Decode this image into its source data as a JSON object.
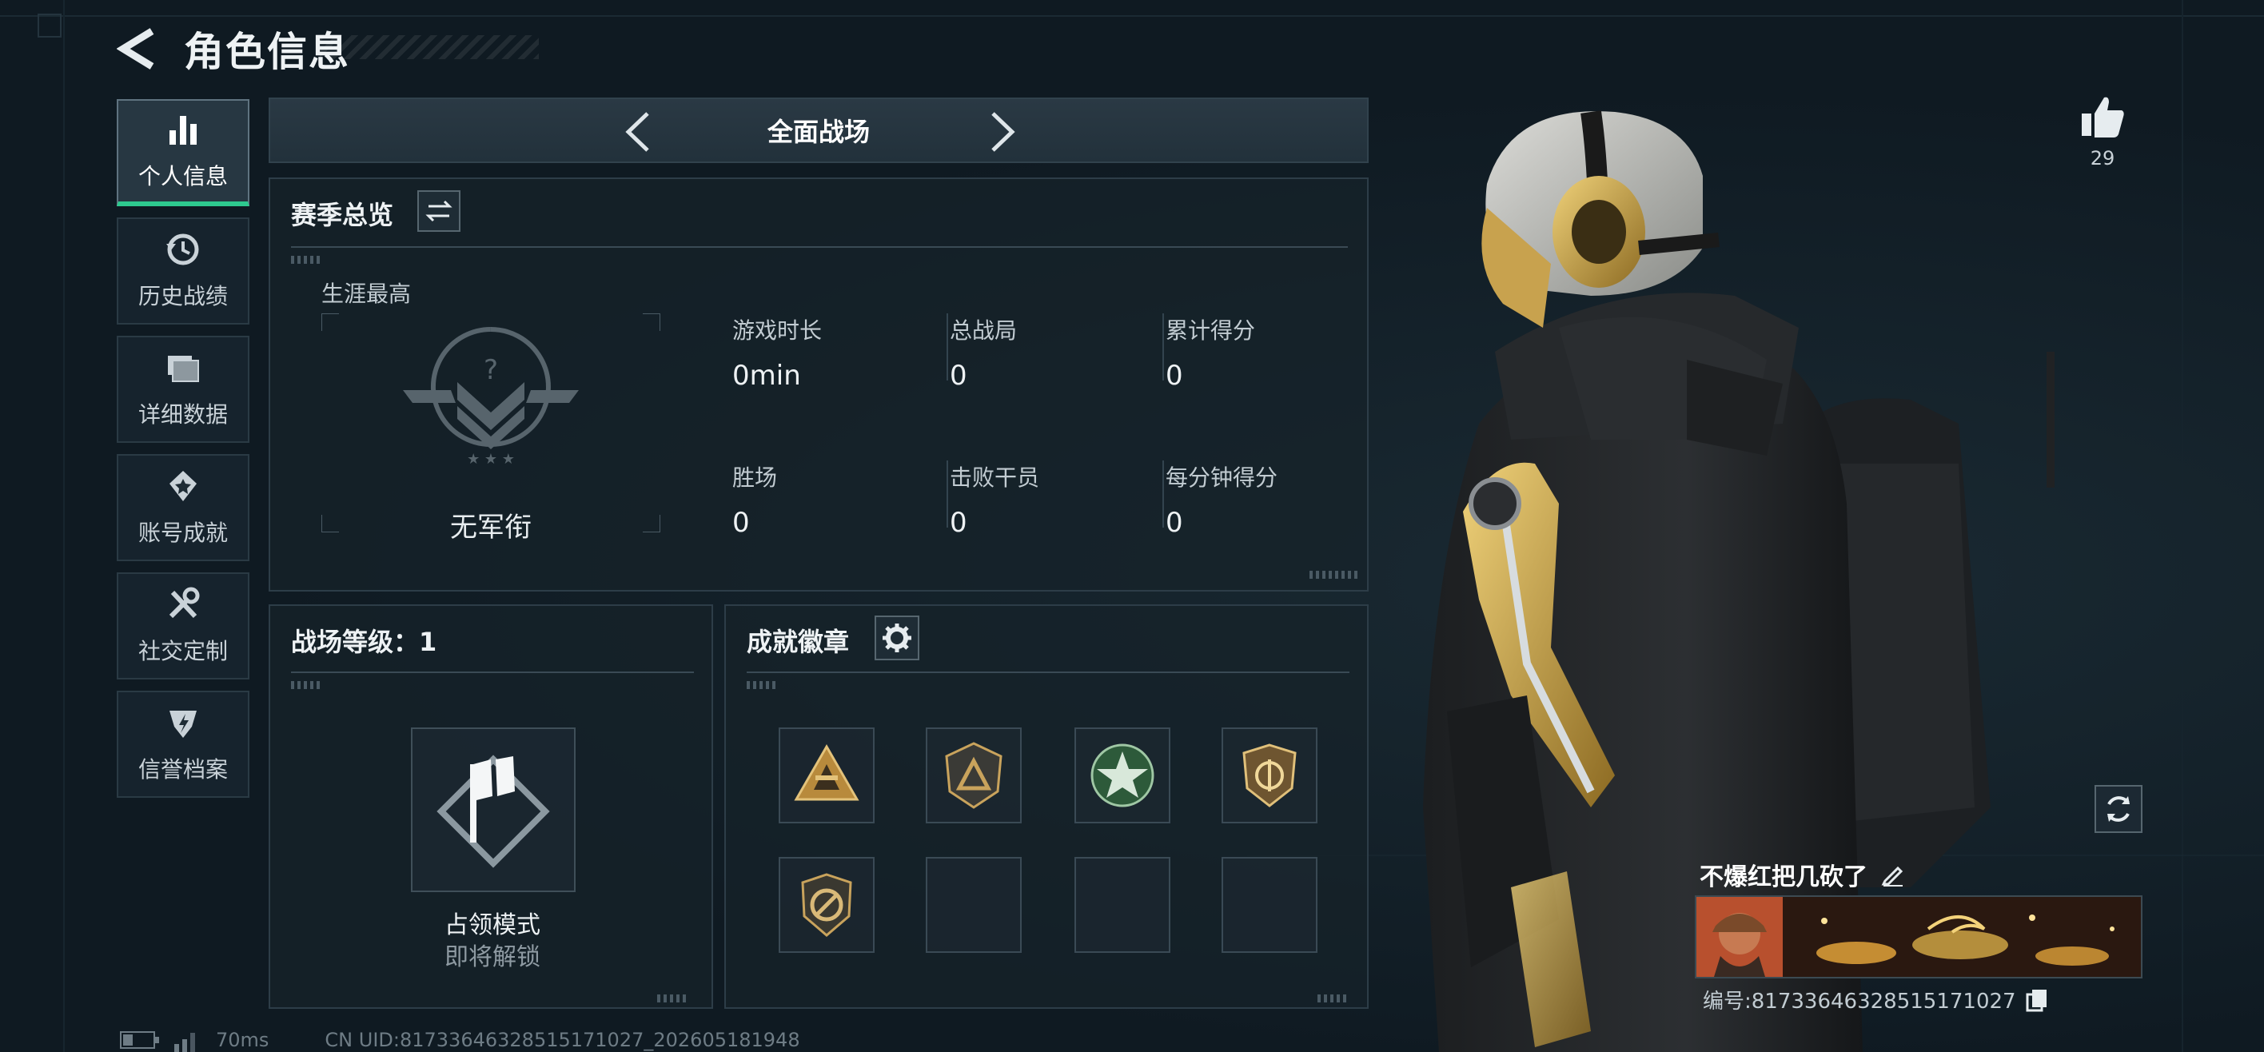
{
  "header": {
    "title": "角色信息"
  },
  "sidebar": {
    "items": [
      {
        "label": "个人信息",
        "icon": "bar-chart-icon",
        "active": true
      },
      {
        "label": "历史战绩",
        "icon": "history-icon"
      },
      {
        "label": "详细数据",
        "icon": "folder-icon"
      },
      {
        "label": "账号成就",
        "icon": "achievement-icon"
      },
      {
        "label": "社交定制",
        "icon": "tools-icon"
      },
      {
        "label": "信誉档案",
        "icon": "credit-badge-icon"
      }
    ]
  },
  "mode_nav": {
    "title": "全面战场"
  },
  "season": {
    "title": "赛季总览",
    "career_label": "生涯最高",
    "rank_label": "无军衔",
    "stats": [
      {
        "label": "游戏时长",
        "value": "0min"
      },
      {
        "label": "总战局",
        "value": "0"
      },
      {
        "label": "累计得分",
        "value": "0"
      },
      {
        "label": "胜场",
        "value": "0"
      },
      {
        "label": "击败干员",
        "value": "0"
      },
      {
        "label": "每分钟得分",
        "value": "0"
      }
    ]
  },
  "level": {
    "title": "战场等级：1",
    "mode_name": "占领模式",
    "mode_status": "即将解锁"
  },
  "achievements": {
    "title": "成就徽章",
    "badges": [
      "gold-triangle-badge",
      "triangle-shield-badge",
      "green-star-badge",
      "gold-shield-badge",
      "no-symbol-badge",
      "",
      "",
      ""
    ]
  },
  "profile": {
    "likes": "29",
    "name": "不爆红把几砍了",
    "id_text": "编号:817336463285151710​27"
  },
  "status_bar": {
    "ping": "70ms",
    "uid": "CN UID:817336463285151710​27_202605181948"
  },
  "colors": {
    "accent": "#2ec98f",
    "panel_border": "#2d3d48",
    "bg": "#0f1a22"
  }
}
